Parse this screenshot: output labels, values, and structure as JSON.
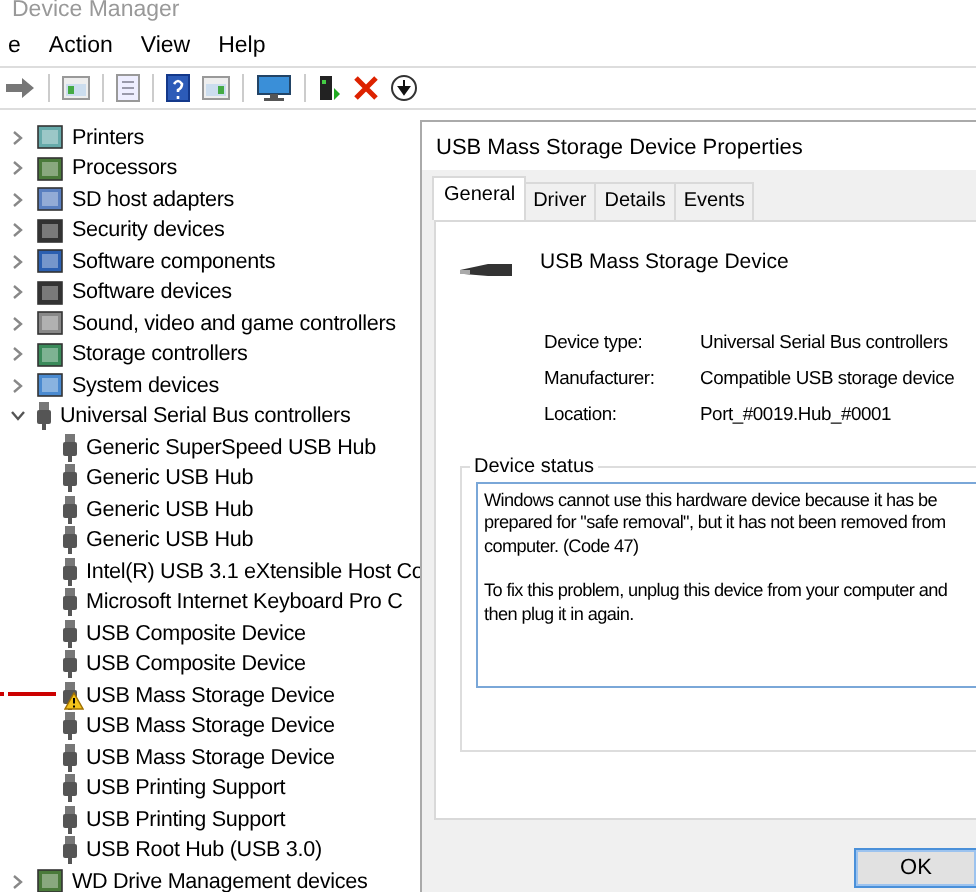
{
  "window": {
    "title": "Device Manager"
  },
  "menu": [
    {
      "label": "e"
    },
    {
      "label": "Action"
    },
    {
      "label": "View"
    },
    {
      "label": "Help"
    }
  ],
  "tree": [
    {
      "label": "Printers",
      "expanded": false
    },
    {
      "label": "Processors",
      "expanded": false
    },
    {
      "label": "SD host adapters",
      "expanded": false
    },
    {
      "label": "Security devices",
      "expanded": false
    },
    {
      "label": "Software components",
      "expanded": false
    },
    {
      "label": "Software devices",
      "expanded": false
    },
    {
      "label": "Sound, video and game controllers",
      "expanded": false
    },
    {
      "label": "Storage controllers",
      "expanded": false
    },
    {
      "label": "System devices",
      "expanded": false
    },
    {
      "label": "Universal Serial Bus controllers",
      "expanded": true,
      "children": [
        {
          "label": "Generic SuperSpeed USB Hub",
          "warning": false
        },
        {
          "label": "Generic USB Hub",
          "warning": false
        },
        {
          "label": "Generic USB Hub",
          "warning": false
        },
        {
          "label": "Generic USB Hub",
          "warning": false
        },
        {
          "label": "Intel(R) USB 3.1 eXtensible Host Co",
          "warning": false
        },
        {
          "label": "Microsoft Internet Keyboard Pro C",
          "warning": false
        },
        {
          "label": "USB Composite Device",
          "warning": false
        },
        {
          "label": "USB Composite Device",
          "warning": false
        },
        {
          "label": "USB Mass Storage Device",
          "warning": true
        },
        {
          "label": "USB Mass Storage Device",
          "warning": false
        },
        {
          "label": "USB Mass Storage Device",
          "warning": false
        },
        {
          "label": "USB Printing Support",
          "warning": false
        },
        {
          "label": "USB Printing Support",
          "warning": false
        },
        {
          "label": "USB Root Hub (USB 3.0)",
          "warning": false
        }
      ]
    },
    {
      "label": "WD Drive Management devices",
      "expanded": false
    }
  ],
  "dialog": {
    "title": "USB Mass Storage Device Properties",
    "tabs": [
      {
        "label": "General",
        "selected": true
      },
      {
        "label": "Driver",
        "selected": false
      },
      {
        "label": "Details",
        "selected": false
      },
      {
        "label": "Events",
        "selected": false
      }
    ],
    "device_name": "USB Mass Storage Device",
    "properties": [
      {
        "label": "Device type:",
        "value": "Universal Serial Bus controllers"
      },
      {
        "label": "Manufacturer:",
        "value": "Compatible USB storage device"
      },
      {
        "label": "Location:",
        "value": "Port_#0019.Hub_#0001"
      }
    ],
    "status": {
      "label": "Device status",
      "paragraphs": [
        [
          "Windows cannot use this hardware device because it has be",
          "prepared for \"safe removal\", but it has not been removed from",
          "computer. (Code 47)"
        ],
        [
          "To fix this problem, unplug this device from your computer and",
          "then plug it in again."
        ]
      ]
    },
    "buttons": [
      "OK"
    ]
  }
}
